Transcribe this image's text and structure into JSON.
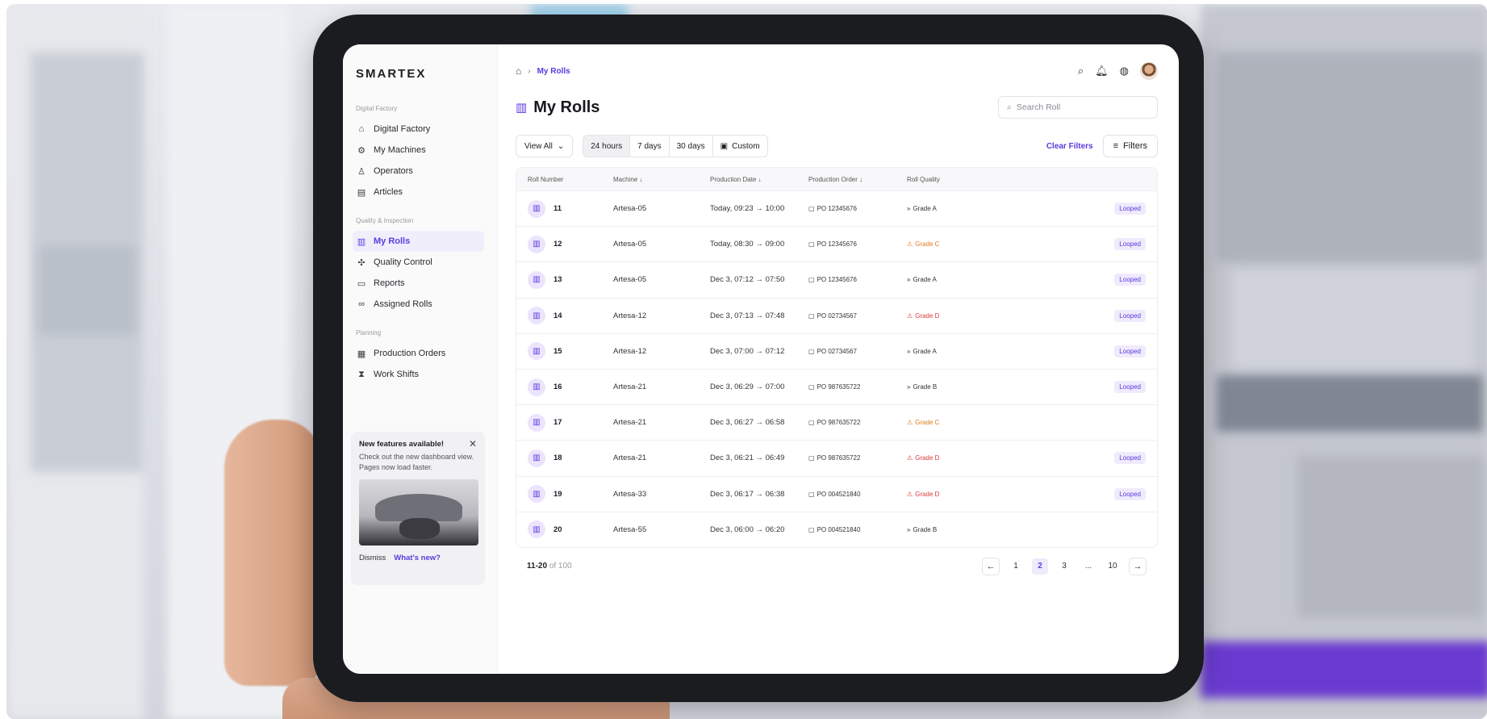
{
  "app": {
    "logo": "SMARTEX"
  },
  "sidebar": {
    "groups": [
      {
        "label": "Digital Factory",
        "items": [
          {
            "label": "Digital Factory",
            "icon": "home-icon"
          },
          {
            "label": "My Machines",
            "icon": "machine-icon"
          },
          {
            "label": "Operators",
            "icon": "operators-icon"
          },
          {
            "label": "Articles",
            "icon": "articles-icon"
          }
        ]
      },
      {
        "label": "Quality & Inspection",
        "items": [
          {
            "label": "My Rolls",
            "icon": "roll-icon",
            "active": true
          },
          {
            "label": "Quality Control",
            "icon": "quality-icon"
          },
          {
            "label": "Reports",
            "icon": "reports-icon"
          },
          {
            "label": "Assigned Rolls",
            "icon": "link-icon"
          }
        ]
      },
      {
        "label": "Planning",
        "items": [
          {
            "label": "Production Orders",
            "icon": "clipboard-icon"
          },
          {
            "label": "Work Shifts",
            "icon": "hourglass-icon"
          }
        ]
      }
    ],
    "promo": {
      "title": "New features available!",
      "body": "Check out the new dashboard view. Pages now load faster.",
      "dismiss": "Dismiss",
      "whats_new": "What's new?"
    }
  },
  "header": {
    "breadcrumb_current": "My Rolls"
  },
  "page": {
    "title": "My Rolls",
    "search_placeholder": "Search Roll"
  },
  "toolbar": {
    "view_all": "View All",
    "ranges": [
      "24 hours",
      "7 days",
      "30 days"
    ],
    "custom": "Custom",
    "clear_filters": "Clear Filters",
    "filters": "Filters"
  },
  "table": {
    "headers": [
      "Roll Number",
      "Machine",
      "Production Date",
      "Production Order",
      "Roll Quality"
    ],
    "rows": [
      {
        "roll": "11",
        "machine": "Artesa-05",
        "date": "Today, 09:23 → 10:00",
        "po": "PO 12345676",
        "grade": "Grade A",
        "grade_class": "a",
        "badge": "Looped"
      },
      {
        "roll": "12",
        "machine": "Artesa-05",
        "date": "Today, 08:30 → 09:00",
        "po": "PO 12345676",
        "grade": "Grade C",
        "grade_class": "c",
        "badge": "Looped"
      },
      {
        "roll": "13",
        "machine": "Artesa-05",
        "date": "Dec 3, 07:12 → 07:50",
        "po": "PO 12345676",
        "grade": "Grade A",
        "grade_class": "a",
        "badge": "Looped"
      },
      {
        "roll": "14",
        "machine": "Artesa-12",
        "date": "Dec 3, 07:13 → 07:48",
        "po": "PO 02734567",
        "grade": "Grade D",
        "grade_class": "d",
        "badge": "Looped"
      },
      {
        "roll": "15",
        "machine": "Artesa-12",
        "date": "Dec 3, 07:00 → 07:12",
        "po": "PO 02734567",
        "grade": "Grade A",
        "grade_class": "a",
        "badge": "Looped"
      },
      {
        "roll": "16",
        "machine": "Artesa-21",
        "date": "Dec 3, 06:29 → 07:00",
        "po": "PO 987635722",
        "grade": "Grade B",
        "grade_class": "b",
        "badge": "Looped"
      },
      {
        "roll": "17",
        "machine": "Artesa-21",
        "date": "Dec 3, 06:27 → 06:58",
        "po": "PO 987635722",
        "grade": "Grade C",
        "grade_class": "c",
        "badge": ""
      },
      {
        "roll": "18",
        "machine": "Artesa-21",
        "date": "Dec 3, 06:21 → 06:49",
        "po": "PO 987635722",
        "grade": "Grade D",
        "grade_class": "d",
        "badge": "Looped"
      },
      {
        "roll": "19",
        "machine": "Artesa-33",
        "date": "Dec 3, 06:17 → 06:38",
        "po": "PO 004521840",
        "grade": "Grade D",
        "grade_class": "d",
        "badge": "Looped"
      },
      {
        "roll": "20",
        "machine": "Artesa-55",
        "date": "Dec 3, 06:00 → 06:20",
        "po": "PO 004521840",
        "grade": "Grade B",
        "grade_class": "b",
        "badge": ""
      }
    ]
  },
  "pagination": {
    "range": "11-20",
    "of": "of 100",
    "pages": [
      "1",
      "2",
      "3",
      "...",
      "10"
    ],
    "current": "2"
  },
  "colors": {
    "accent": "#5b3ae0",
    "grade_c": "#e07a1b",
    "grade_d": "#d93a3a"
  }
}
